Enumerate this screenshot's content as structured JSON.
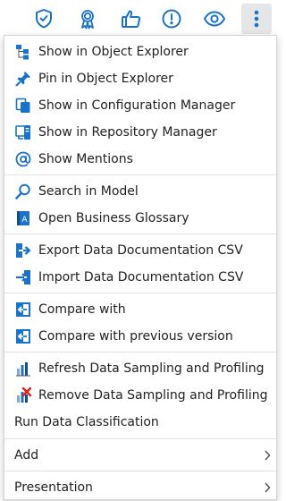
{
  "toolbar": {
    "icons": [
      "shield-check-icon",
      "award-ribbon-icon",
      "thumbs-up-icon",
      "alert-circle-icon",
      "eye-icon",
      "more-vertical-icon"
    ],
    "accent": "#1a73c8"
  },
  "menu": {
    "items": [
      {
        "label": "Show in Object Explorer",
        "icon": "tree-hierarchy-icon"
      },
      {
        "label": "Pin in Object Explorer",
        "icon": "pin-icon"
      },
      {
        "label": "Show in Configuration Manager",
        "icon": "copy-pages-icon"
      },
      {
        "label": "Show in Repository Manager",
        "icon": "repository-icon"
      },
      {
        "label": "Show Mentions",
        "icon": "at-sign-icon"
      },
      {
        "label": "Search in Model",
        "icon": "search-icon"
      },
      {
        "label": "Open Business Glossary",
        "icon": "glossary-book-icon"
      },
      {
        "label": "Export Data Documentation CSV",
        "icon": "export-icon"
      },
      {
        "label": "Import Data Documentation CSV",
        "icon": "import-icon"
      },
      {
        "label": "Compare with",
        "icon": "compare-icon"
      },
      {
        "label": "Compare with previous version",
        "icon": "compare-icon"
      },
      {
        "label": "Refresh Data Sampling and Profiling",
        "icon": "bar-chart-icon"
      },
      {
        "label": "Remove Data Sampling and Profiling",
        "icon": "bar-chart-remove-icon"
      },
      {
        "label": "Run Data Classification",
        "icon": ""
      },
      {
        "label": "Add",
        "icon": "",
        "submenu": true
      },
      {
        "label": "Presentation",
        "icon": "",
        "submenu": true
      }
    ]
  }
}
